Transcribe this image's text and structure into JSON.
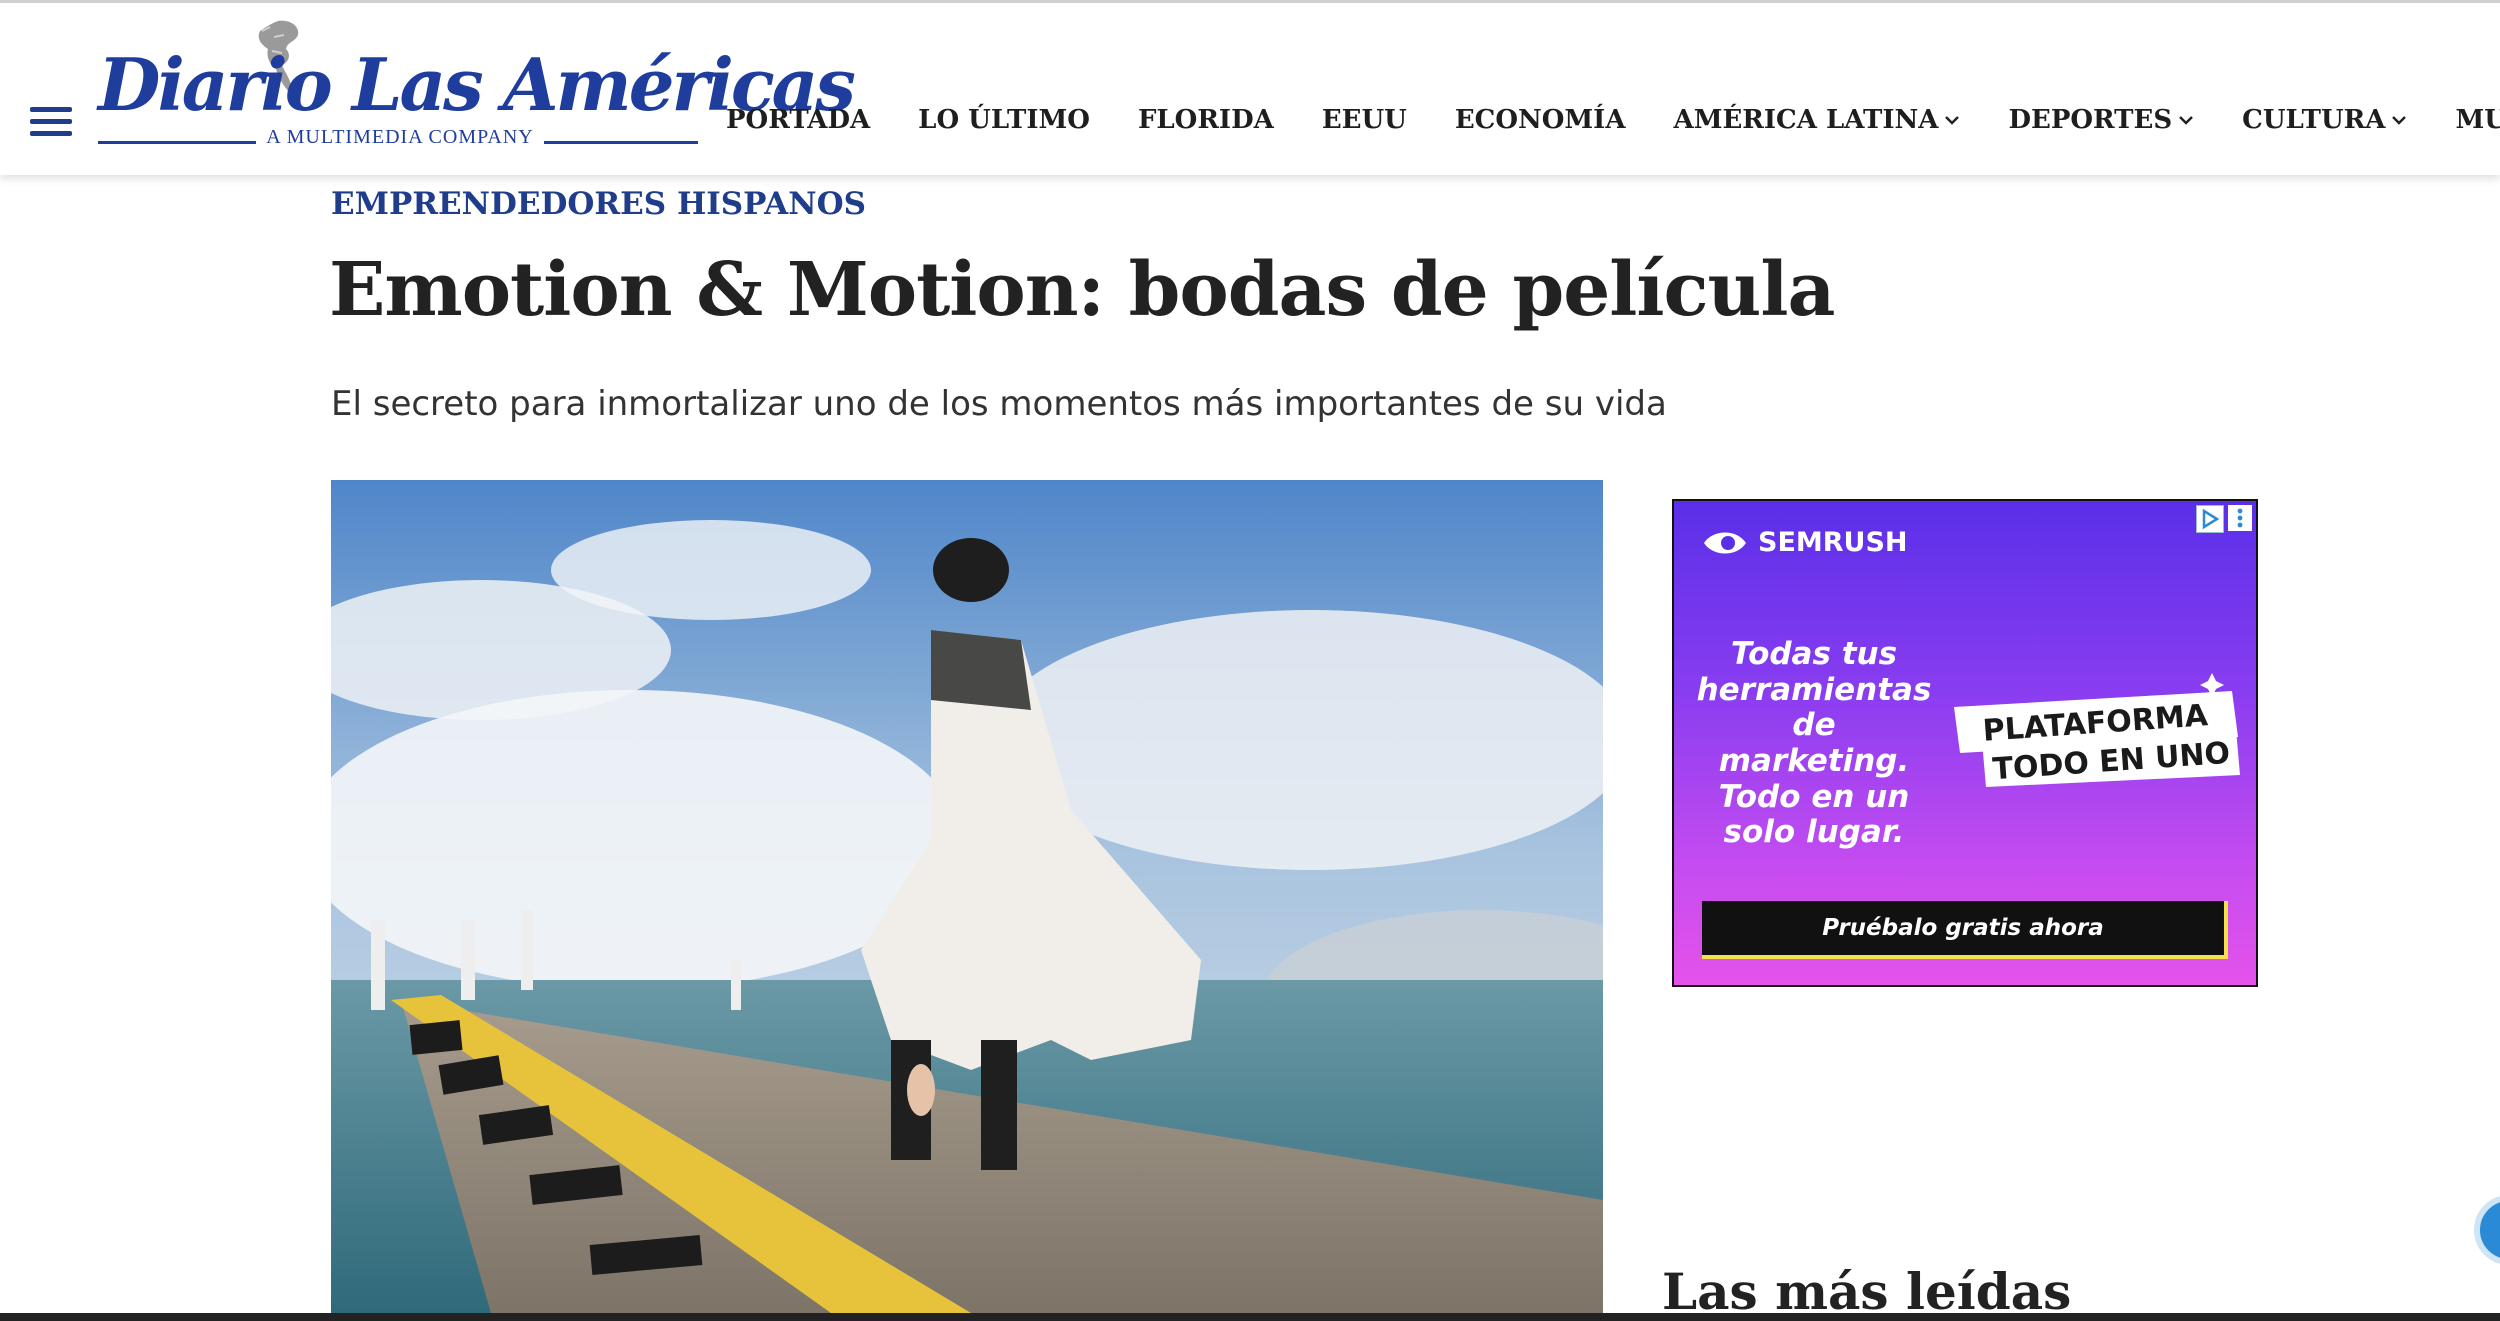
{
  "header": {
    "logo": {
      "main": "Diario Las Américas",
      "sub": "A MULTIMEDIA COMPANY"
    },
    "nav": [
      {
        "label": "PORTADA",
        "dropdown": false
      },
      {
        "label": "LO ÚLTIMO",
        "dropdown": false
      },
      {
        "label": "FLORIDA",
        "dropdown": false
      },
      {
        "label": "EEUU",
        "dropdown": false
      },
      {
        "label": "ECONOMÍA",
        "dropdown": false
      },
      {
        "label": "AMÉRICA LATINA",
        "dropdown": true
      },
      {
        "label": "DEPORTES",
        "dropdown": true
      },
      {
        "label": "CULTURA",
        "dropdown": true
      },
      {
        "label": "MUNDO",
        "dropdown": false
      }
    ]
  },
  "article": {
    "kicker": "EMPRENDEDORES HISPANOS",
    "title": "Emotion & Motion: bodas de película",
    "subtitle": "El secreto para inmortalizar uno de los momentos más importantes de su vida"
  },
  "ad": {
    "brand": "SEMRUSH",
    "text_lines": [
      "Todas tus",
      "herramientas",
      "de marketing.",
      "Todo en un",
      "solo lugar."
    ],
    "badge_lines": [
      "PLATAFORMA",
      "TODO EN UNO"
    ],
    "cta": "Pruébalo gratis ahora"
  },
  "sidebar": {
    "most_read_title": "Las más leídas"
  },
  "icons": {
    "menu": "hamburger-menu-icon",
    "dropdown": "chevron-down-icon",
    "ad_choices": "ad-choices-icon",
    "ad_options": "kebab-menu-icon",
    "chat": "chat-bubble-icon"
  },
  "colors": {
    "brand_blue": "#1f3d9c",
    "kicker_blue": "#1f3d8a",
    "ad_purple": "#5a2fe8",
    "ad_pink": "#e552ea",
    "ad_cta_accent": "#f4e04a"
  }
}
